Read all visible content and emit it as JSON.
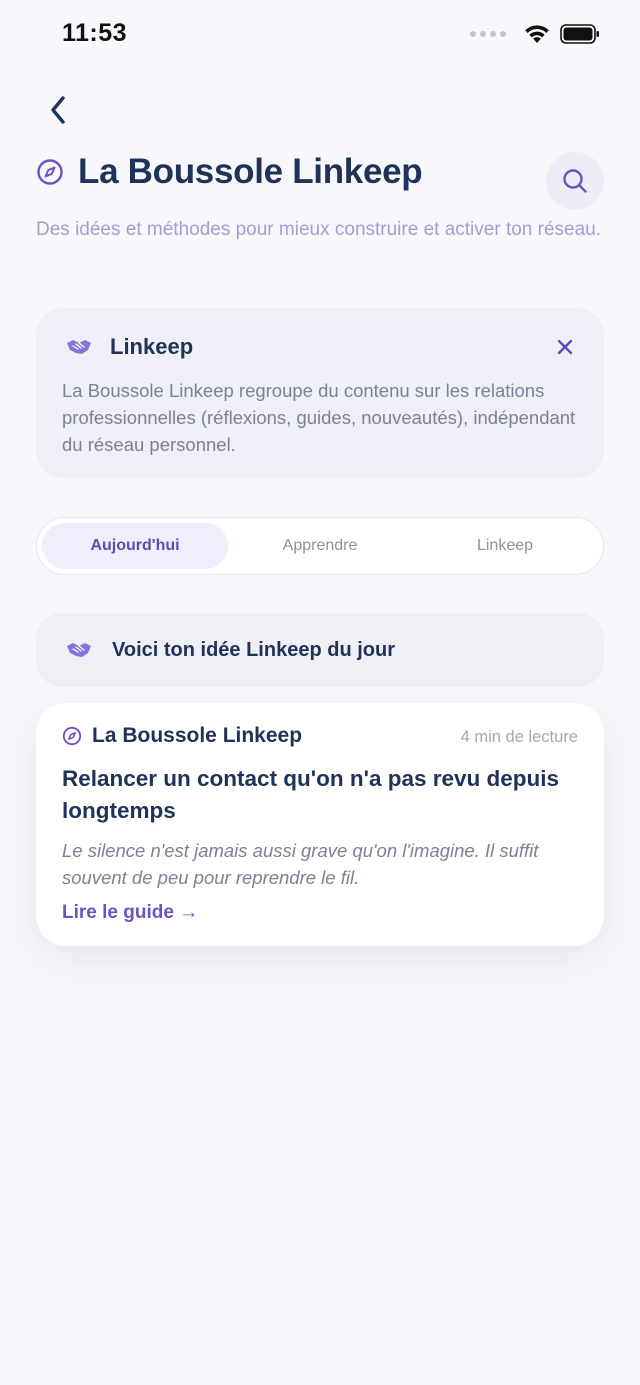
{
  "status_bar": {
    "time": "11:53"
  },
  "header": {
    "title": "La Boussole Linkeep",
    "subtitle": "Des idées et méthodes pour mieux construire et activer ton réseau."
  },
  "info_card": {
    "title": "Linkeep",
    "body": "La Boussole Linkeep regroupe du contenu sur les relations professionnelles (réflexions, guides, nouveautés), indépendant du réseau personnel."
  },
  "tabs": [
    {
      "label": "Aujourd'hui",
      "active": true
    },
    {
      "label": "Apprendre",
      "active": false
    },
    {
      "label": "Linkeep",
      "active": false
    }
  ],
  "daily_idea": {
    "label": "Voici ton idée Linkeep du jour"
  },
  "article": {
    "source": "La Boussole Linkeep",
    "read_time": "4 min de lecture",
    "title": "Relancer un contact qu'on n'a pas revu depuis longtemps",
    "excerpt": "Le silence n'est jamais aussi grave qu'on l'imagine. Il suffit souvent de peu pour reprendre le fil.",
    "cta": "Lire le guide →"
  },
  "colors": {
    "background": "#f8f8fc",
    "navy": "#1f3258",
    "accent_purple": "#6d52c4",
    "subtitle_lavender": "#a29fd0"
  },
  "icons": [
    "back-chevron-icon",
    "compass-icon",
    "search-icon",
    "handshake-icon",
    "close-icon",
    "wifi-icon",
    "battery-icon"
  ]
}
